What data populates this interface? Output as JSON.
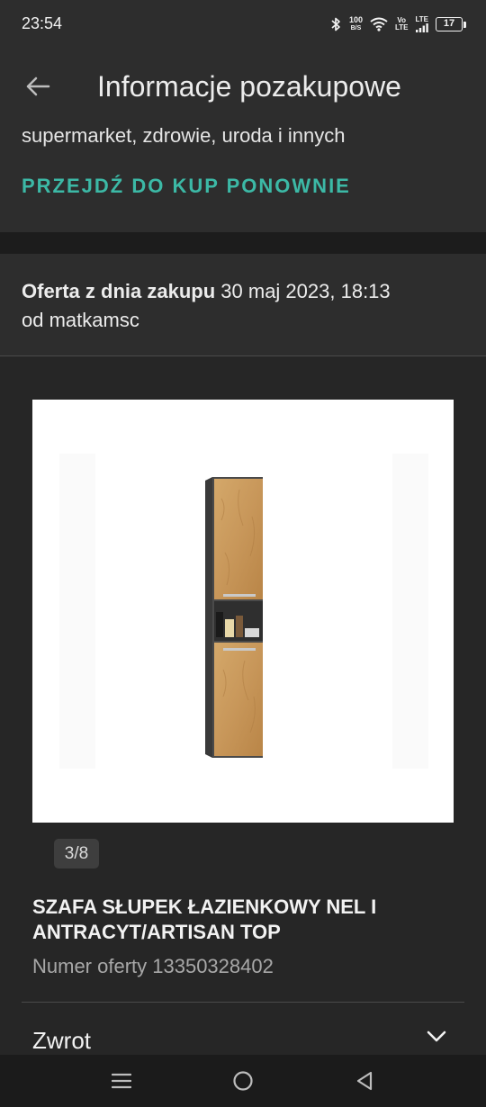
{
  "status_bar": {
    "time": "23:54",
    "speed_value": "100",
    "speed_unit": "B/S",
    "volte_top": "Vo",
    "volte_bottom": "LTE",
    "lte": "LTE",
    "battery": "17",
    "icons": [
      "bluetooth-icon",
      "wifi-icon",
      "signal-icon",
      "battery-icon"
    ]
  },
  "app_bar": {
    "title": "Informacje pozakupowe",
    "back_icon": "arrow-left-icon"
  },
  "top_card": {
    "categories_text": "supermarket, zdrowie, uroda i innych",
    "rebuy_link": "PRZEJDŹ DO KUP PONOWNIE"
  },
  "offer": {
    "label": "Oferta z dnia zakupu",
    "date": "30 maj 2023, 18:13",
    "seller_line": "od matkamsc"
  },
  "product": {
    "image_counter": "3/8",
    "title": "SZAFA SŁUPEK ŁAZIENKOWY NEL I ANTRACYT/ARTISAN TOP",
    "offer_number": "Numer oferty 13350328402"
  },
  "return_section": {
    "label": "Zwrot",
    "icon": "chevron-down-icon"
  },
  "nav_bar": {
    "icons": [
      "menu-icon",
      "home-icon",
      "back-triangle-icon"
    ]
  },
  "colors": {
    "accent": "#3cb9a6",
    "background": "#262626",
    "card": "#2d2d2d"
  }
}
